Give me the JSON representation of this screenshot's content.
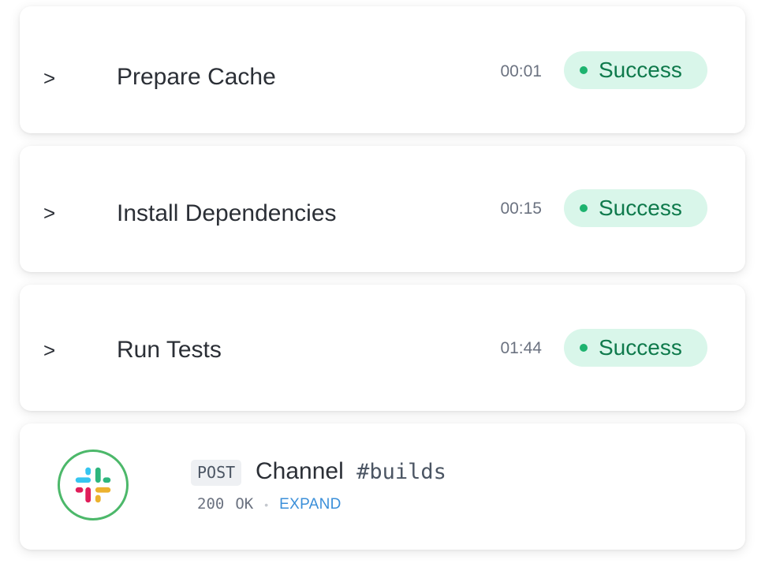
{
  "steps": [
    {
      "chevron": ">",
      "name": "Prepare Cache",
      "duration": "00:01",
      "status": "Success"
    },
    {
      "chevron": ">",
      "name": "Install Dependencies",
      "duration": "00:15",
      "status": "Success"
    },
    {
      "chevron": ">",
      "name": "Run Tests",
      "duration": "01:44",
      "status": "Success"
    }
  ],
  "webhook": {
    "icon": "slack-logo-icon",
    "method": "POST",
    "title": "Channel",
    "channel": "#builds",
    "status_code": "200",
    "status_text": "OK",
    "separator": "•",
    "expand_label": "EXPAND"
  },
  "colors": {
    "success_bg": "#d9f6ea",
    "success_text": "#0f7a4c",
    "success_dot": "#1db36f",
    "link": "#3b8fd9",
    "avatar_ring": "#4cb86a"
  }
}
